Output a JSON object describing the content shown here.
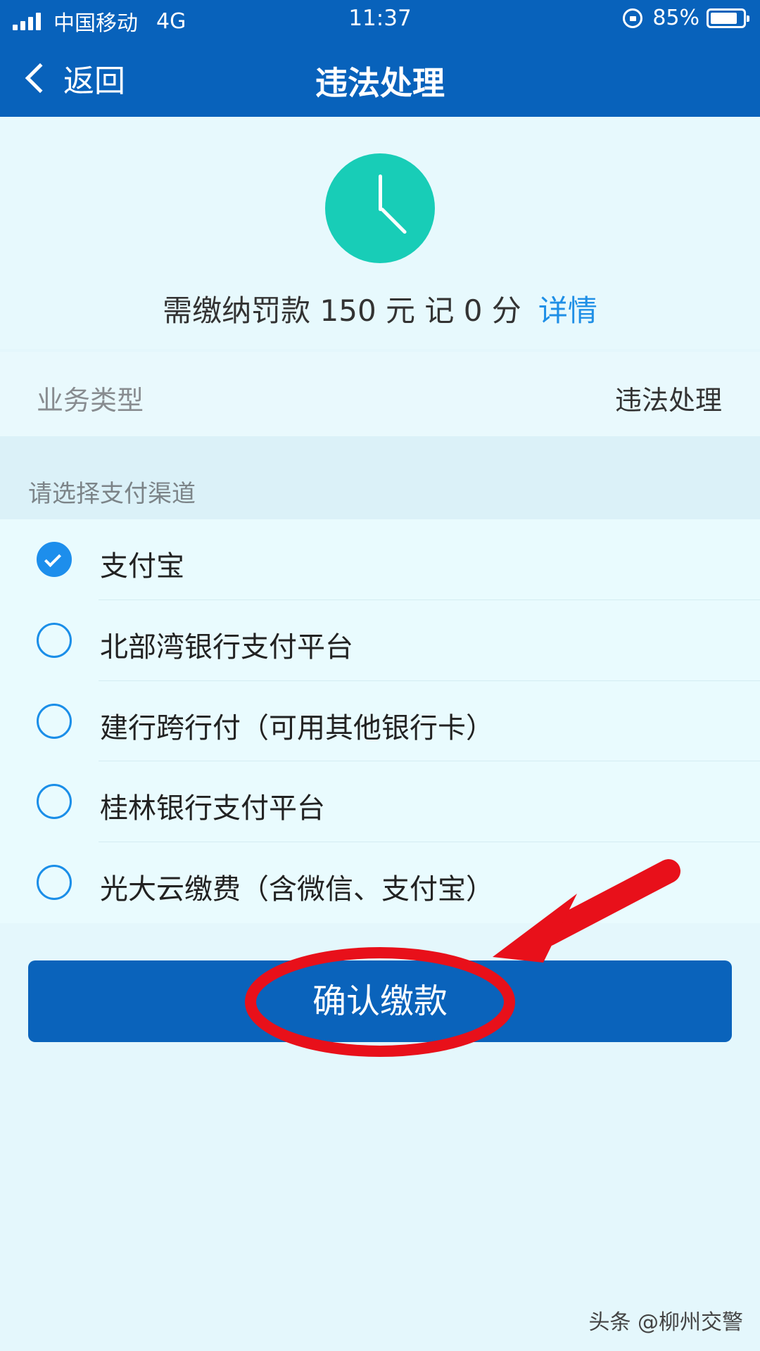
{
  "status_bar": {
    "carrier": "中国移动",
    "network": "4G",
    "time": "11:37",
    "battery": "85%",
    "battery_level": 0.85
  },
  "nav": {
    "back_label": "返回",
    "title": "违法处理"
  },
  "summary": {
    "fine_text": "需缴纳罚款 150 元  记 0 分",
    "detail_link": "详情"
  },
  "business": {
    "label": "业务类型",
    "value": "违法处理"
  },
  "payment": {
    "section_title": "请选择支付渠道",
    "options": [
      {
        "label": "支付宝",
        "selected": true
      },
      {
        "label": "北部湾银行支付平台",
        "selected": false
      },
      {
        "label": "建行跨行付（可用其他银行卡）",
        "selected": false
      },
      {
        "label": "桂林银行支付平台",
        "selected": false
      },
      {
        "label": "光大云缴费（含微信、支付宝）",
        "selected": false
      }
    ]
  },
  "confirm_button": "确认缴款",
  "watermark": "头条 @柳州交警",
  "colors": {
    "header_blue": "#0862bb",
    "accent_blue": "#1d8eec",
    "clock_teal": "#18cdb7",
    "annotation_red": "#e8101a"
  }
}
